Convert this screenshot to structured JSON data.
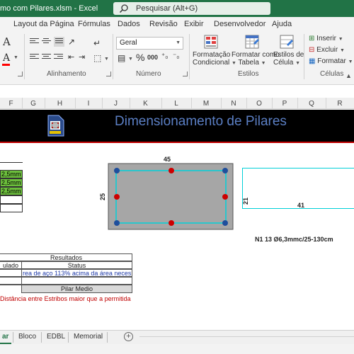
{
  "window": {
    "title": "mo com  Pilares.xlsm  -  Excel",
    "search_placeholder": "Pesquisar (Alt+G)"
  },
  "ribbon_tabs": [
    "Layout da Página",
    "Fórmulas",
    "Dados",
    "Revisão",
    "Exibir",
    "Desenvolvedor",
    "Ajuda"
  ],
  "ribbon": {
    "groups": {
      "alignment": "Alinhamento",
      "number": "Número",
      "styles": "Estilos",
      "cells": "Células"
    },
    "number_format": "Geral",
    "percent_symbol": "%",
    "thousands_symbol": "000",
    "conditional_formatting": [
      "Formatação",
      "Condicional"
    ],
    "format_as_table": [
      "Formatar como",
      "Tabela"
    ],
    "cell_styles": [
      "Estilos de",
      "Célula"
    ],
    "insert": "Inserir",
    "delete": "Excluir",
    "format": "Formatar",
    "font_color_letter": "A",
    "fill_letter": "A"
  },
  "columns": [
    "F",
    "G",
    "H",
    "I",
    "J",
    "K",
    "L",
    "M",
    "N",
    "O",
    "P",
    "Q",
    "R"
  ],
  "sheet": {
    "banner_title": "Dimensionamento de Pilares",
    "input_cells": [
      "2,5mm",
      "2,5mm",
      "2,5mm"
    ],
    "section": {
      "width_label": "45",
      "height_label": "25",
      "stirrup_height": "21",
      "stirrup_width": "41",
      "rebar_label": "N1 13 Ø6,3mmc/25-130cm"
    },
    "results": {
      "header": "Resultados",
      "col1": "ulado",
      "col2": "Status",
      "status_text": "rea de aço 113% acima da área necessária",
      "pillar_type": "Pilar Medio"
    },
    "warning": "Distância entre Estribos maior que a permitida"
  },
  "sheet_tabs": [
    "ar",
    "Bloco",
    "EDBL",
    "Memorial"
  ],
  "colors": {
    "excel_green": "#217346",
    "input_green": "#6cbf3c",
    "rebar_red": "#cc0000",
    "rebar_blue": "#1f4e9c",
    "stirrup_cyan": "#00d0d8",
    "title_blue": "#5b7fc4"
  }
}
